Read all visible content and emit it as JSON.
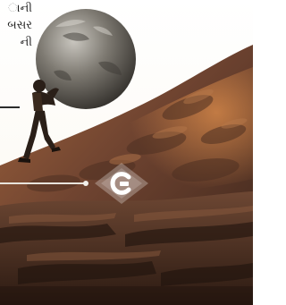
{
  "article": {
    "text_lines": [
      "ાની",
      "બસર",
      "ની"
    ]
  },
  "logo": {
    "icon": "brand-logo-icon",
    "color": "#ffffff"
  },
  "colors": {
    "sky": "#fdfcf7",
    "boulder": "#6e6b64",
    "rock": "#7a4e33",
    "shadow": "#2a1a12"
  }
}
